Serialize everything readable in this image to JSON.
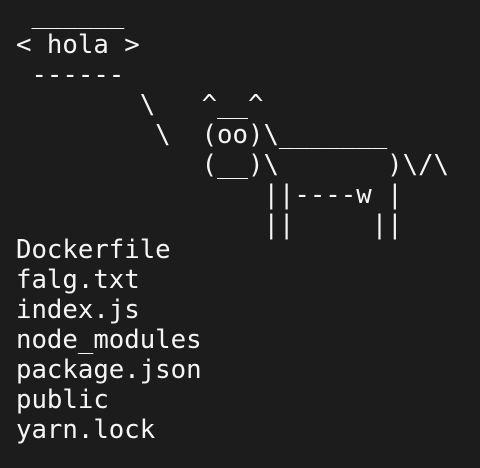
{
  "terminal": {
    "background": "#1c1c1c",
    "foreground": "#f5f5f5",
    "cowsay_output": " ______\n< hola >\n ------\n        \\   ^__^\n         \\  (oo)\\_______\n            (__)\\       )\\/\\\n                ||----w |\n                ||     ||",
    "files": [
      "Dockerfile",
      "falg.txt",
      "index.js",
      "node_modules",
      "package.json",
      "public",
      "yarn.lock"
    ]
  }
}
